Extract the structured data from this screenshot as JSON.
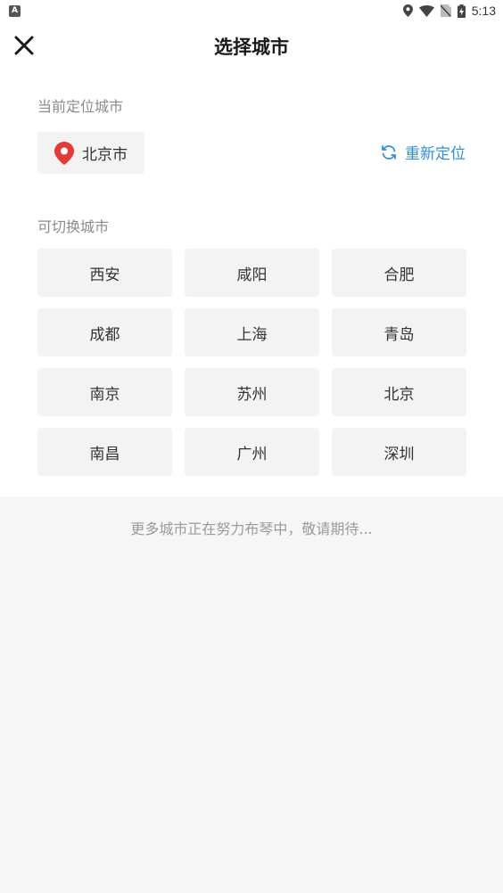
{
  "status_bar": {
    "left_icon": "a-notification-icon",
    "time": "5:13",
    "icons": [
      "location-icon",
      "wifi-icon",
      "no-sim-icon",
      "battery-charging-icon"
    ]
  },
  "header": {
    "title": "选择城市",
    "close_icon": "close-icon"
  },
  "current_location": {
    "label": "当前定位城市",
    "city": "北京市",
    "pin_icon": "location-pin-icon",
    "pin_color": "#e53935",
    "relocate_label": "重新定位",
    "relocate_icon": "refresh-icon",
    "relocate_color": "#2d8fe0"
  },
  "switchable": {
    "label": "可切换城市",
    "cities": [
      "西安",
      "咸阳",
      "合肥",
      "成都",
      "上海",
      "青岛",
      "南京",
      "苏州",
      "北京",
      "南昌",
      "广州",
      "深圳"
    ]
  },
  "footer_note": "更多城市正在努力布琴中，敬请期待..."
}
